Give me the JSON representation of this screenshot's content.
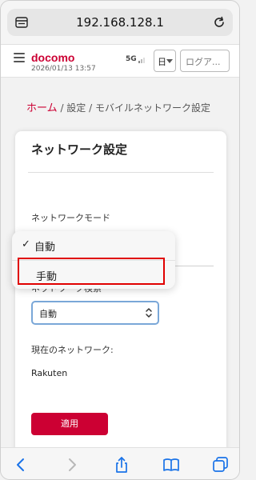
{
  "browser": {
    "url": "192.168.128.1"
  },
  "header": {
    "brand": "docomo",
    "datetime": "2026/01/13 13:57",
    "network": "5G",
    "language": "日",
    "login_label": "ログア..."
  },
  "breadcrumb": {
    "home": "ホーム",
    "sep": " / ",
    "level1": "設定",
    "level2": "モバイルネットワーク設定"
  },
  "card": {
    "title": "ネットワーク設定",
    "network_mode_label": "ネットワークモード",
    "network_search_label": "ネットワーク検索",
    "search_value": "自動",
    "current_network_label": "現在のネットワーク:",
    "current_network_value": "Rakuten",
    "apply_label": "適用"
  },
  "dropdown": {
    "options": [
      {
        "label": "自動",
        "selected": true
      },
      {
        "label": "手動",
        "selected": false
      }
    ],
    "check_glyph": "✓"
  },
  "colors": {
    "accent": "#cc0033",
    "highlight": "#e00000",
    "ios_blue": "#1a73e8"
  }
}
